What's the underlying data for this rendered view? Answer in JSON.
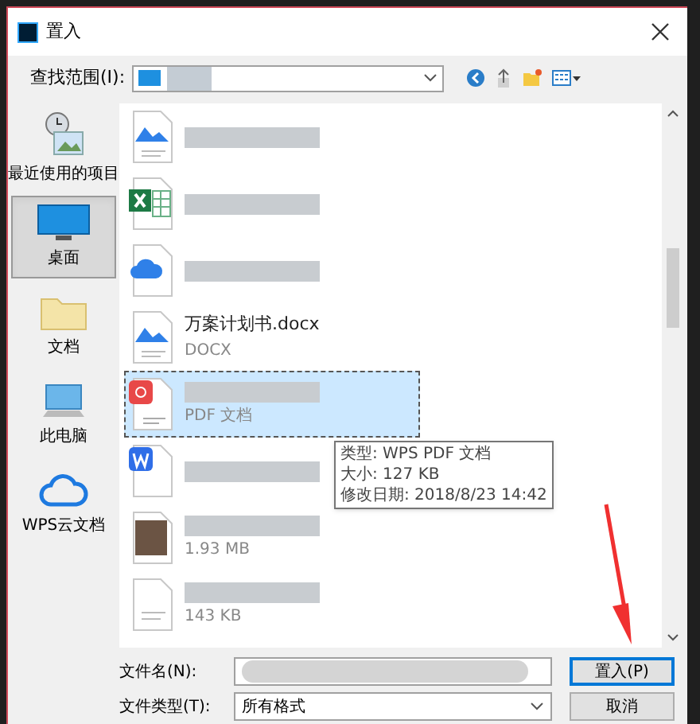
{
  "window": {
    "title": "置入"
  },
  "toolbar": {
    "look_in_label": "查找范围(I):"
  },
  "sidebar": {
    "items": [
      {
        "label": "最近使用的项目",
        "kind": "recent",
        "selected": false
      },
      {
        "label": "桌面",
        "kind": "desktop",
        "selected": true
      },
      {
        "label": "文档",
        "kind": "documents",
        "selected": false
      },
      {
        "label": "此电脑",
        "kind": "computer",
        "selected": false
      },
      {
        "label": "WPS云文档",
        "kind": "cloud",
        "selected": false
      }
    ]
  },
  "files": [
    {
      "kind": "image",
      "selected": false
    },
    {
      "kind": "excel",
      "selected": false
    },
    {
      "kind": "cloud",
      "selected": false
    },
    {
      "kind": "image",
      "name": "万案计划书.docx",
      "detail": "DOCX",
      "selected": false
    },
    {
      "kind": "pdf",
      "detail": "PDF 文档",
      "selected": true
    },
    {
      "kind": "word",
      "selected": false
    },
    {
      "kind": "photo",
      "detail": "1.93 MB",
      "selected": false
    },
    {
      "kind": "doc",
      "detail": "143 KB",
      "selected": false
    }
  ],
  "tooltip": [
    "类型: WPS PDF 文档",
    "大小: 127 KB",
    "修改日期: 2018/8/23 14:42"
  ],
  "footer": {
    "file_name_label": "文件名(N):",
    "file_type_label": "文件类型(T):",
    "file_type_value": "所有格式",
    "buttons": [
      "置入(P)",
      "取消"
    ]
  }
}
